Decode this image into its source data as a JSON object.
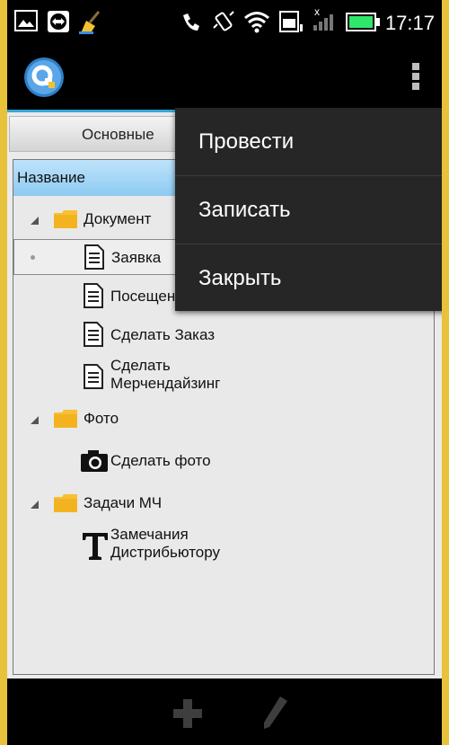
{
  "status_bar": {
    "time": "17:17",
    "icons": [
      "image-icon",
      "teamviewer-icon",
      "cleaner-broom-icon",
      "phone-icon",
      "vibrate-icon",
      "wifi-icon",
      "sd-card-icon",
      "signal-icon",
      "battery-icon"
    ],
    "battery_color": "#2ee86b"
  },
  "action_bar": {
    "accent_color": "#35a7d8"
  },
  "tab": {
    "label": "Основные"
  },
  "tree": {
    "column_header": "Название",
    "items": [
      {
        "label": "Документ",
        "type": "folder",
        "level": 0,
        "expanded": true
      },
      {
        "label": "Заявка",
        "type": "document",
        "level": 1,
        "selected": true
      },
      {
        "label": "Посещение",
        "type": "document",
        "level": 1
      },
      {
        "label": "Сделать Заказ",
        "type": "document",
        "level": 1
      },
      {
        "label": "Сделать",
        "label_line2": "Мерчендайзинг",
        "type": "document",
        "level": 1
      },
      {
        "label": "Фото",
        "type": "folder",
        "level": 0,
        "expanded": true
      },
      {
        "label": "Сделать фото",
        "type": "camera",
        "level": 1
      },
      {
        "label": "Задачи МЧ",
        "type": "folder",
        "level": 0,
        "expanded": true
      },
      {
        "label": "Замечания",
        "label_line2": "Дистрибьютору",
        "type": "text",
        "level": 1
      }
    ]
  },
  "menu": {
    "items": [
      "Провести",
      "Записать",
      "Закрыть"
    ]
  },
  "bottom_bar": {
    "icons": [
      "plus-icon",
      "pencil-icon"
    ]
  }
}
